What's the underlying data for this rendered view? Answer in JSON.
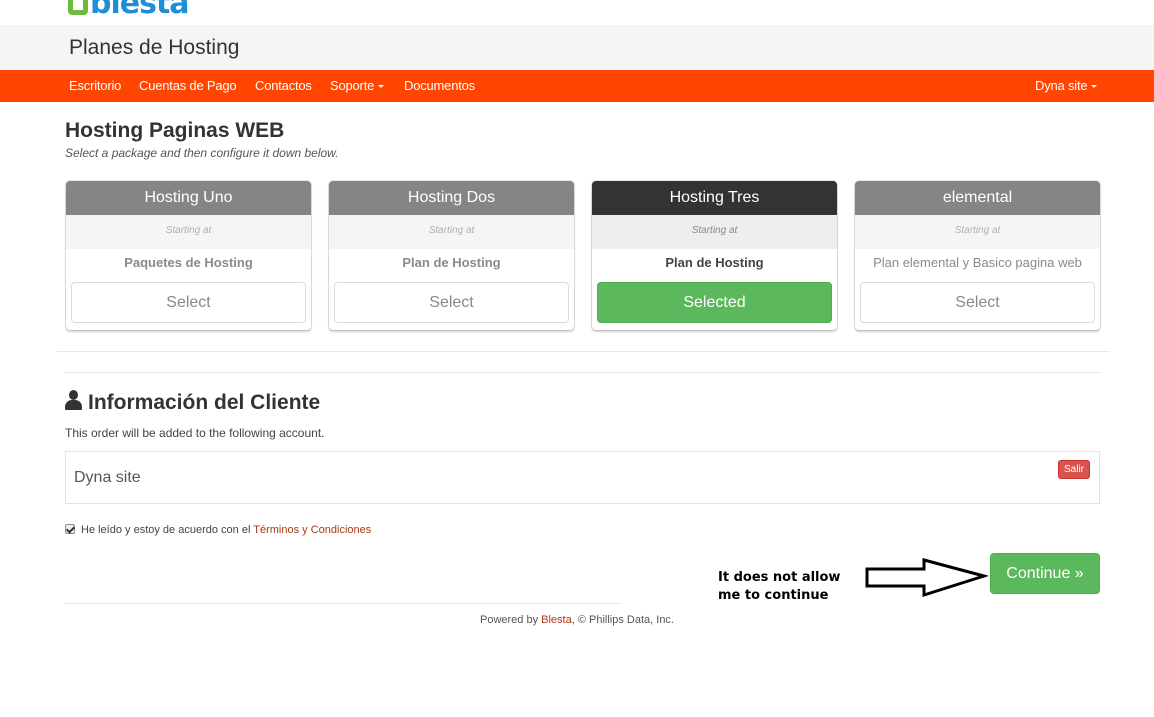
{
  "logo": {
    "text": "blesta"
  },
  "header": {
    "title": "Planes de Hosting"
  },
  "nav": {
    "items": [
      {
        "label": "Escritorio"
      },
      {
        "label": "Cuentas de Pago"
      },
      {
        "label": "Contactos"
      },
      {
        "label": "Soporte",
        "dropdown": true
      },
      {
        "label": "Documentos"
      }
    ],
    "user_menu": {
      "label": "Dyna site",
      "dropdown": true
    },
    "color": "#ff4500"
  },
  "packages_section": {
    "title": "Hosting Paginas WEB",
    "subtitle": "Select a package and then configure it down below."
  },
  "packages": [
    {
      "name": "Hosting Uno",
      "starting": "Starting at",
      "description": "Paquetes de Hosting",
      "button": "Select",
      "selected": false
    },
    {
      "name": "Hosting Dos",
      "starting": "Starting at",
      "description": "Plan de Hosting",
      "button": "Select",
      "selected": false
    },
    {
      "name": "Hosting Tres",
      "starting": "Starting at",
      "description": "Plan de Hosting",
      "button": "Selected",
      "selected": true
    },
    {
      "name": "elemental",
      "starting": "Starting at",
      "description": "Plan elemental y Basico pagina web",
      "button": "Select",
      "selected": false
    }
  ],
  "client": {
    "title": "Información del Cliente",
    "subtitle": "This order will be added to the following account.",
    "account_name": "Dyna site",
    "logout_label": "Salir"
  },
  "terms": {
    "text": "He leído y estoy de acuerdo con el",
    "link": "Términos y Condiciones",
    "checked": true
  },
  "annotation": {
    "text": "It does not allow me to continue"
  },
  "continue_label": "Continue »",
  "footer": {
    "prefix": "Powered by",
    "link": "Blesta",
    "suffix": ", © Phillips Data, Inc."
  },
  "colors": {
    "accent": "#ff4500",
    "success": "#5cb85c",
    "danger": "#d9534f",
    "link": "#a83a12"
  }
}
